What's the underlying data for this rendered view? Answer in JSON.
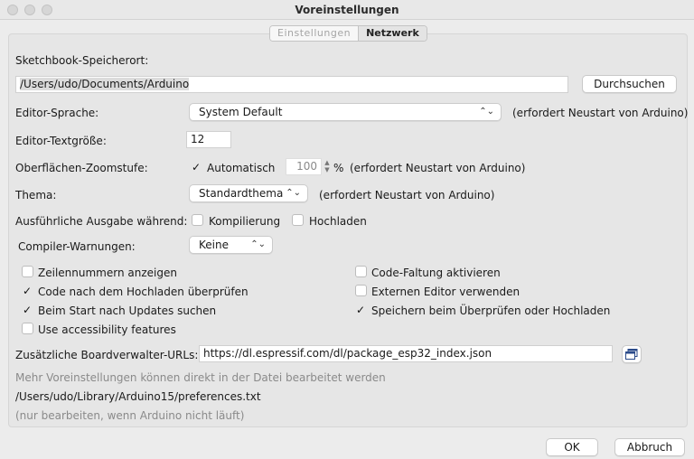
{
  "window": {
    "title": "Voreinstellungen"
  },
  "tabs": [
    {
      "label": "Einstellungen",
      "active": false
    },
    {
      "label": "Netzwerk",
      "active": true
    }
  ],
  "sketchbook": {
    "label": "Sketchbook-Speicherort:",
    "path": "/Users/udo/Documents/Arduino",
    "browse_label": "Durchsuchen"
  },
  "editor_language": {
    "label": "Editor-Sprache:",
    "value": "System Default",
    "note": "(erfordert Neustart von Arduino)"
  },
  "editor_font_size": {
    "label": "Editor-Textgröße:",
    "value": "12"
  },
  "zoom": {
    "label": "Oberflächen-Zoomstufe:",
    "auto_label": "Automatisch",
    "auto_checked": true,
    "value": "100",
    "unit": "%",
    "note": "(erfordert Neustart von Arduino)"
  },
  "theme": {
    "label": "Thema:",
    "value": "Standardthema",
    "note": "(erfordert Neustart von Arduino)"
  },
  "verbose": {
    "label": "Ausführliche Ausgabe während:",
    "compile_label": "Kompilierung",
    "compile_checked": false,
    "upload_label": "Hochladen",
    "upload_checked": false
  },
  "compiler_warnings": {
    "label": "Compiler-Warnungen:",
    "value": "Keine"
  },
  "options": {
    "line_numbers": {
      "label": "Zeilennummern anzeigen",
      "checked": false
    },
    "verify_code": {
      "label": "Code nach dem Hochladen überprüfen",
      "checked": true
    },
    "check_updates": {
      "label": "Beim Start nach Updates suchen",
      "checked": true
    },
    "accessibility": {
      "label": "Use accessibility features",
      "checked": false
    },
    "code_folding": {
      "label": "Code-Faltung aktivieren",
      "checked": false
    },
    "external_editor": {
      "label": "Externen Editor verwenden",
      "checked": false
    },
    "save_on_verify": {
      "label": "Speichern beim Überprüfen oder Hochladen",
      "checked": true
    }
  },
  "board_urls": {
    "label": "Zusätzliche Boardverwalter-URLs:",
    "value": "https://dl.espressif.com/dl/package_esp32_index.json"
  },
  "footer": {
    "more_prefs": "Mehr Voreinstellungen können direkt in der Datei bearbeitet werden",
    "prefs_path": "/Users/udo/Library/Arduino15/preferences.txt",
    "edit_note": "(nur bearbeiten, wenn Arduino nicht läuft)"
  },
  "buttons": {
    "ok": "OK",
    "cancel": "Abbruch"
  },
  "check_glyph": "✓",
  "colors": {
    "window_bg": "#ececec",
    "panel_bg": "#e6e6e6",
    "field_bg": "#ffffff"
  }
}
